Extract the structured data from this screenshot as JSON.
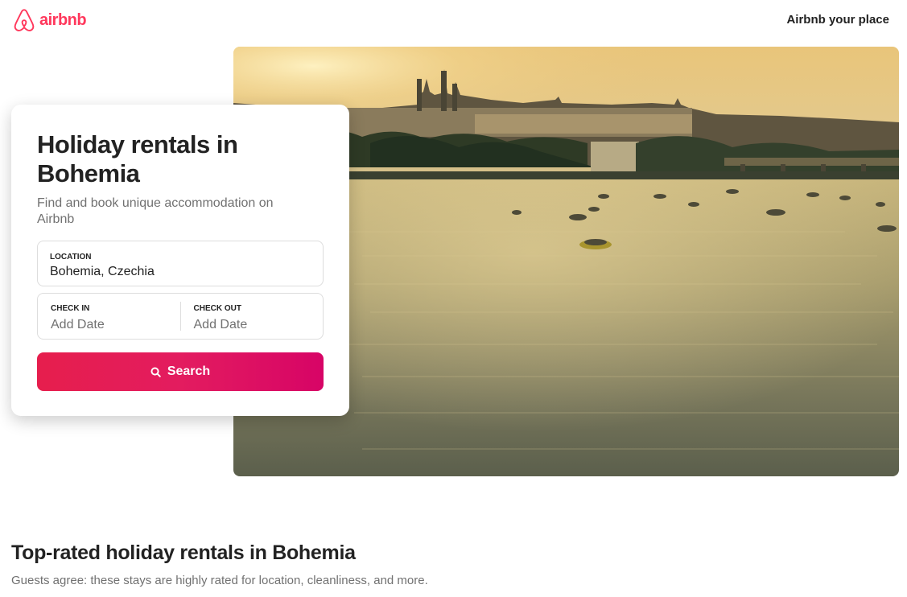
{
  "brand": {
    "name": "airbnb",
    "color": "#ff385c",
    "logo_icon": "airbnb-belo-icon"
  },
  "header": {
    "host_link": "Airbnb your place"
  },
  "hero": {
    "image": "prague-castle-vltava-river-sunset-photo"
  },
  "search_card": {
    "title": "Holiday rentals in Bohemia",
    "subtitle": "Find and book unique accommodation on Airbnb",
    "location": {
      "label": "LOCATION",
      "value": "Bohemia, Czechia"
    },
    "check_in": {
      "label": "CHECK IN",
      "placeholder": "Add Date"
    },
    "check_out": {
      "label": "CHECK OUT",
      "placeholder": "Add Date"
    },
    "search_button": {
      "label": "Search",
      "icon": "search-icon",
      "gradient": [
        "#e61e4d",
        "#e31c5f",
        "#d70466"
      ]
    }
  },
  "top_rated": {
    "title": "Top-rated holiday rentals in Bohemia",
    "subtitle": "Guests agree: these stays are highly rated for location, cleanliness, and more."
  }
}
